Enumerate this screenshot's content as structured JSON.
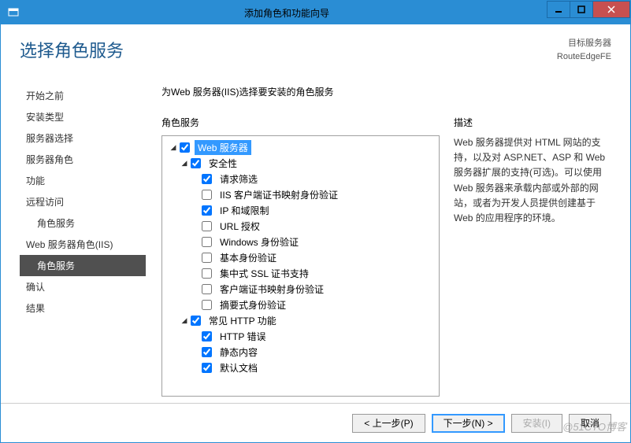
{
  "titlebar": {
    "title": "添加角色和功能向导"
  },
  "header": {
    "page_title": "选择角色服务",
    "target_label": "目标服务器",
    "target_value": "RouteEdgeFE"
  },
  "sidebar": {
    "items": [
      {
        "label": "开始之前",
        "indent": 0,
        "active": false
      },
      {
        "label": "安装类型",
        "indent": 0,
        "active": false
      },
      {
        "label": "服务器选择",
        "indent": 0,
        "active": false
      },
      {
        "label": "服务器角色",
        "indent": 0,
        "active": false
      },
      {
        "label": "功能",
        "indent": 0,
        "active": false
      },
      {
        "label": "远程访问",
        "indent": 0,
        "active": false
      },
      {
        "label": "角色服务",
        "indent": 1,
        "active": false
      },
      {
        "label": "Web 服务器角色(IIS)",
        "indent": 0,
        "active": false
      },
      {
        "label": "角色服务",
        "indent": 1,
        "active": true
      },
      {
        "label": "确认",
        "indent": 0,
        "active": false
      },
      {
        "label": "结果",
        "indent": 0,
        "active": false
      }
    ]
  },
  "main": {
    "instruction": "为Web 服务器(IIS)选择要安装的角色服务",
    "roles_label": "角色服务",
    "desc_label": "描述",
    "description": "Web 服务器提供对 HTML 网站的支持，以及对 ASP.NET、ASP 和 Web 服务器扩展的支持(可选)。可以使用 Web 服务器来承载内部或外部的网站，或者为开发人员提供创建基于 Web 的应用程序的环境。",
    "tree": [
      {
        "depth": 0,
        "toggle": "open",
        "checked": true,
        "label": "Web 服务器",
        "selected": true
      },
      {
        "depth": 1,
        "toggle": "open",
        "checked": true,
        "label": "安全性"
      },
      {
        "depth": 2,
        "toggle": null,
        "checked": true,
        "label": "请求筛选"
      },
      {
        "depth": 2,
        "toggle": null,
        "checked": false,
        "label": "IIS 客户端证书映射身份验证"
      },
      {
        "depth": 2,
        "toggle": null,
        "checked": true,
        "label": "IP 和域限制"
      },
      {
        "depth": 2,
        "toggle": null,
        "checked": false,
        "label": "URL 授权"
      },
      {
        "depth": 2,
        "toggle": null,
        "checked": false,
        "label": "Windows 身份验证"
      },
      {
        "depth": 2,
        "toggle": null,
        "checked": false,
        "label": "基本身份验证"
      },
      {
        "depth": 2,
        "toggle": null,
        "checked": false,
        "label": "集中式 SSL 证书支持"
      },
      {
        "depth": 2,
        "toggle": null,
        "checked": false,
        "label": "客户端证书映射身份验证"
      },
      {
        "depth": 2,
        "toggle": null,
        "checked": false,
        "label": "摘要式身份验证"
      },
      {
        "depth": 1,
        "toggle": "open",
        "checked": true,
        "label": "常见 HTTP 功能"
      },
      {
        "depth": 2,
        "toggle": null,
        "checked": true,
        "label": "HTTP 错误"
      },
      {
        "depth": 2,
        "toggle": null,
        "checked": true,
        "label": "静态内容"
      },
      {
        "depth": 2,
        "toggle": null,
        "checked": true,
        "label": "默认文档"
      }
    ]
  },
  "buttons": {
    "prev": "< 上一步(P)",
    "next": "下一步(N) >",
    "install": "安装(I)",
    "cancel": "取消"
  },
  "watermark": "@51CTO博客"
}
